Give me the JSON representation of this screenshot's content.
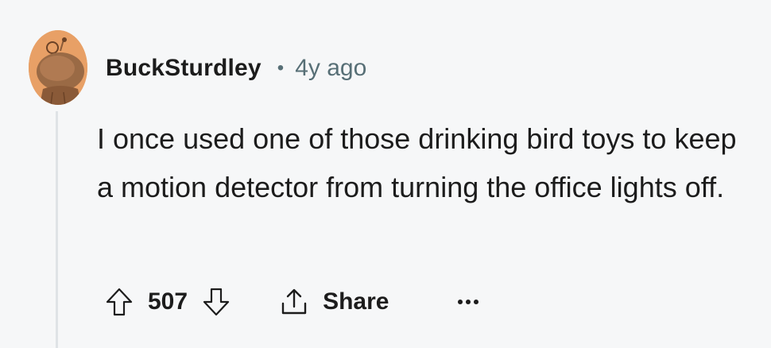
{
  "comment": {
    "author": "BuckSturdley",
    "separator": "•",
    "age": "4y ago",
    "text": "I once used one of those drinking bird toys to keep a motion detector from turning the office lights off.",
    "avatar_color": "#e8a066"
  },
  "actions": {
    "score": "507",
    "share_label": "Share",
    "upvote_icon": "arrow-up-outline-icon",
    "downvote_icon": "arrow-down-outline-icon",
    "share_icon": "share-upload-icon",
    "more_icon": "ellipsis-horizontal-icon"
  },
  "colors": {
    "background": "#f6f7f8",
    "text": "#1c1c1c",
    "meta": "#576f76",
    "thread_line": "#dfe3e6"
  }
}
